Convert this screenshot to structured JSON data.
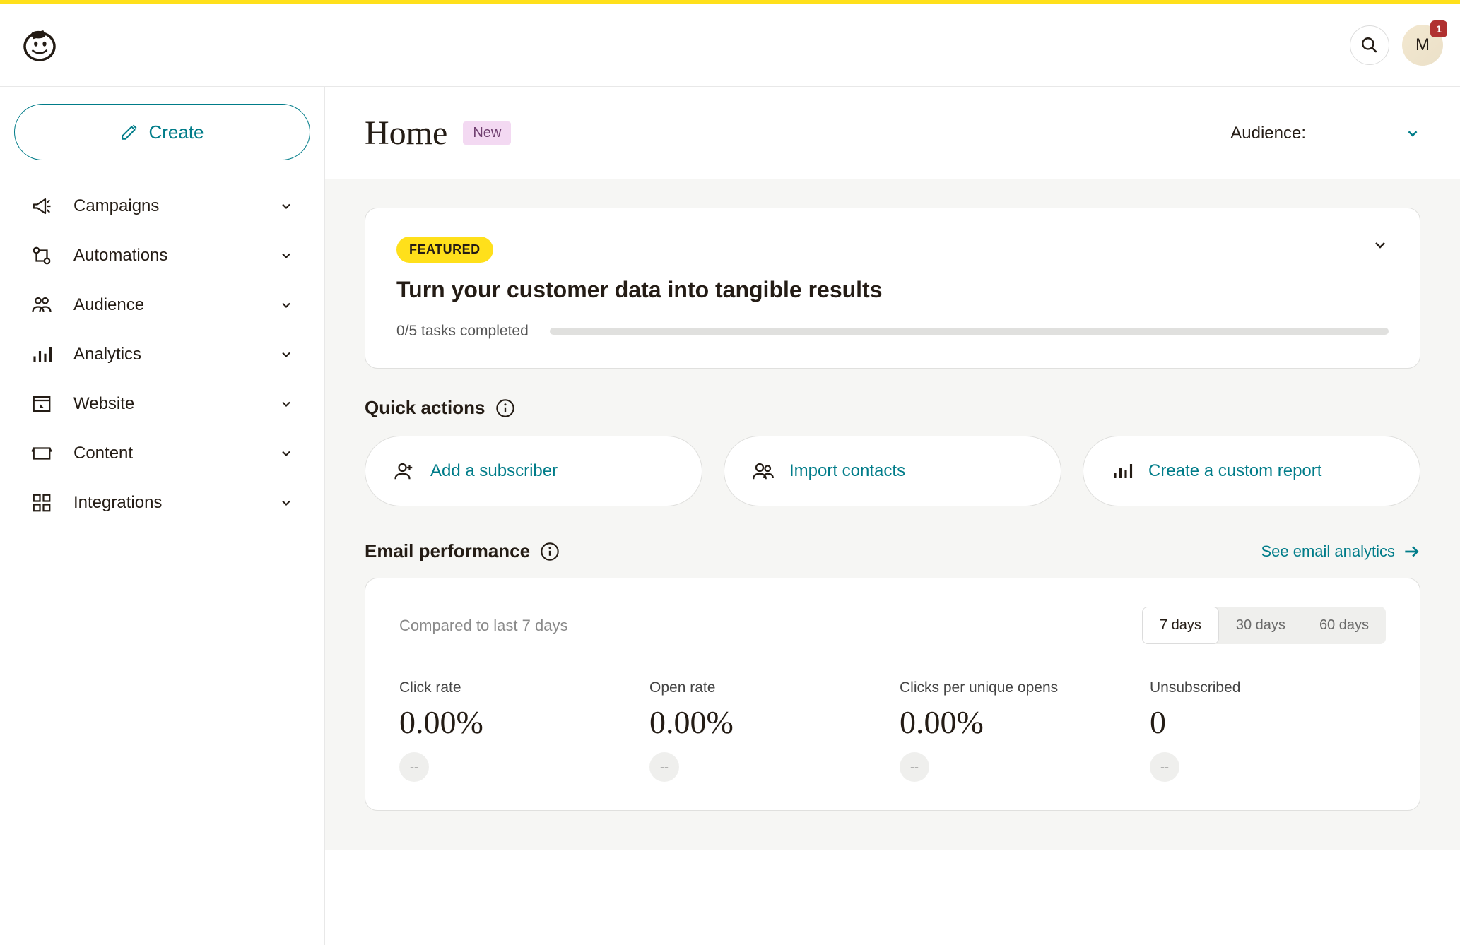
{
  "header": {
    "avatar_initial": "M",
    "badge_count": "1"
  },
  "sidebar": {
    "create_label": "Create",
    "items": [
      {
        "label": "Campaigns"
      },
      {
        "label": "Automations"
      },
      {
        "label": "Audience"
      },
      {
        "label": "Analytics"
      },
      {
        "label": "Website"
      },
      {
        "label": "Content"
      },
      {
        "label": "Integrations"
      }
    ]
  },
  "page": {
    "title": "Home",
    "new_badge": "New",
    "audience_label": "Audience:"
  },
  "featured": {
    "badge": "FEATURED",
    "title": "Turn your customer data into tangible results",
    "progress_text": "0/5 tasks completed"
  },
  "quick_actions": {
    "title": "Quick actions",
    "items": [
      {
        "label": "Add a subscriber"
      },
      {
        "label": "Import contacts"
      },
      {
        "label": "Create a custom report"
      }
    ]
  },
  "email_perf": {
    "title": "Email performance",
    "see_link": "See email analytics",
    "compared_text": "Compared to last 7 days",
    "periods": [
      "7 days",
      "30 days",
      "60 days"
    ],
    "metrics": [
      {
        "label": "Click rate",
        "value": "0.00%",
        "change": "--"
      },
      {
        "label": "Open rate",
        "value": "0.00%",
        "change": "--"
      },
      {
        "label": "Clicks per unique opens",
        "value": "0.00%",
        "change": "--"
      },
      {
        "label": "Unsubscribed",
        "value": "0",
        "change": "--"
      }
    ]
  }
}
